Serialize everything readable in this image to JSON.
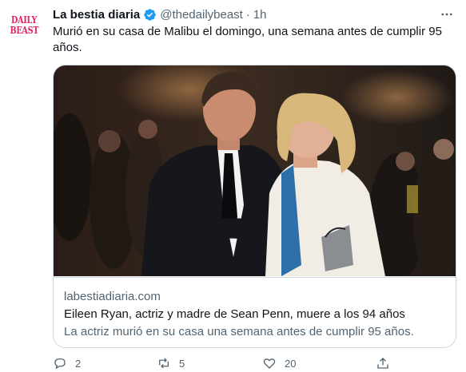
{
  "tweet": {
    "avatar_lines": [
      "DAILY",
      "BEAST"
    ],
    "author_name": "La bestia diaria",
    "handle": "@thedailybeast",
    "separator": "·",
    "time": "1h",
    "more_icon": "more-horizontal-icon",
    "verified_icon": "verified-badge-icon",
    "text": "Murió en su casa de Malibu el domingo, una semana antes de cumplir 95 años."
  },
  "card": {
    "domain": "labestiadiaria.com",
    "title": "Eileen Ryan, actriz y madre de Sean Penn, muere a los 94 años",
    "description": "La actriz murió en su casa una semana antes de cumplir 95 años."
  },
  "actions": {
    "reply_count": "2",
    "retweet_count": "5",
    "like_count": "20"
  },
  "colors": {
    "brand": "#e0245e",
    "verified": "#1d9bf0",
    "text_primary": "#0f1419",
    "text_secondary": "#536471",
    "border": "#cfd9de"
  }
}
